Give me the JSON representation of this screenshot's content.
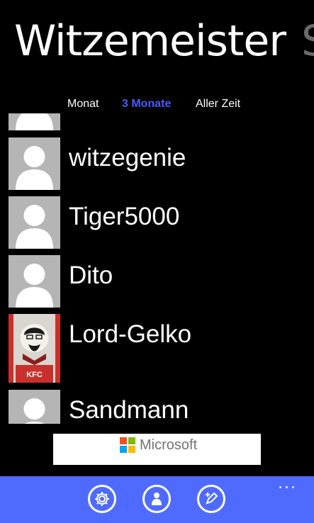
{
  "header": {
    "title": "Witzemeister",
    "next_pivot_title": "S"
  },
  "filters": [
    {
      "label": "Monat",
      "active": false
    },
    {
      "label": "3 Monate",
      "active": true
    },
    {
      "label": "Aller Zeit",
      "active": false
    }
  ],
  "users": [
    {
      "name": "witzegenie",
      "avatar": "default-avatar-icon"
    },
    {
      "name": "Tiger5000",
      "avatar": "default-avatar-icon"
    },
    {
      "name": "Dito",
      "avatar": "default-avatar-icon"
    },
    {
      "name": "Lord-Gelko",
      "avatar": "kfc-bucket-photo"
    },
    {
      "name": "Sandmann",
      "avatar": "default-avatar-icon"
    }
  ],
  "ad": {
    "brand": "Microsoft",
    "logo_colors": [
      "#f25022",
      "#7fba00",
      "#00a4ef",
      "#ffb900"
    ]
  },
  "appbar": {
    "background": "#4f6bff",
    "buttons": [
      {
        "icon": "gear-icon"
      },
      {
        "icon": "person-icon"
      },
      {
        "icon": "edit-icon"
      }
    ],
    "more": "..."
  },
  "colors": {
    "accent": "#4a5bff",
    "avatar_bg": "#b5b5b5"
  }
}
